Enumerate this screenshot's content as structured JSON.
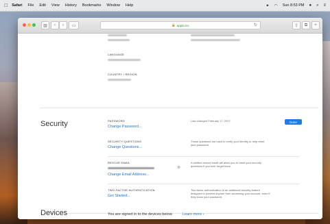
{
  "menubar": {
    "apple": "",
    "app_name": "Safari",
    "items": [
      "File",
      "Edit",
      "View",
      "History",
      "Bookmarks",
      "Window",
      "Help"
    ],
    "clock": "Sun 8:53 PM"
  },
  "browser": {
    "address": "apple.inc",
    "reload": "↻"
  },
  "account": {
    "language_label": "LANGUAGE",
    "country_label": "COUNTRY / REGION"
  },
  "security": {
    "title": "Security",
    "password_label": "PASSWORD",
    "password_link": "Change Password...",
    "last_changed": "Last changed February 17, 2017",
    "done": "Done",
    "questions_label": "SECURITY QUESTIONS",
    "questions_link": "Change Questions...",
    "questions_desc": "These questions are used to verify your identity or help reset your password.",
    "rescue_label": "RESCUE EMAIL",
    "rescue_link": "Change Email Address...",
    "rescue_desc": "A verified rescue email will allow you to reset your security questions if you ever forget them.",
    "twofactor_label": "TWO-FACTOR AUTHENTICATION",
    "twofactor_link": "Get Started...",
    "twofactor_desc": "Two-factor authentication is an additional security feature designed to prevent anyone from accessing your account, even if they know your password."
  },
  "devices": {
    "title": "Devices",
    "signed_in": "You are signed in to the devices below.",
    "learn_more": "Learn more ›"
  }
}
